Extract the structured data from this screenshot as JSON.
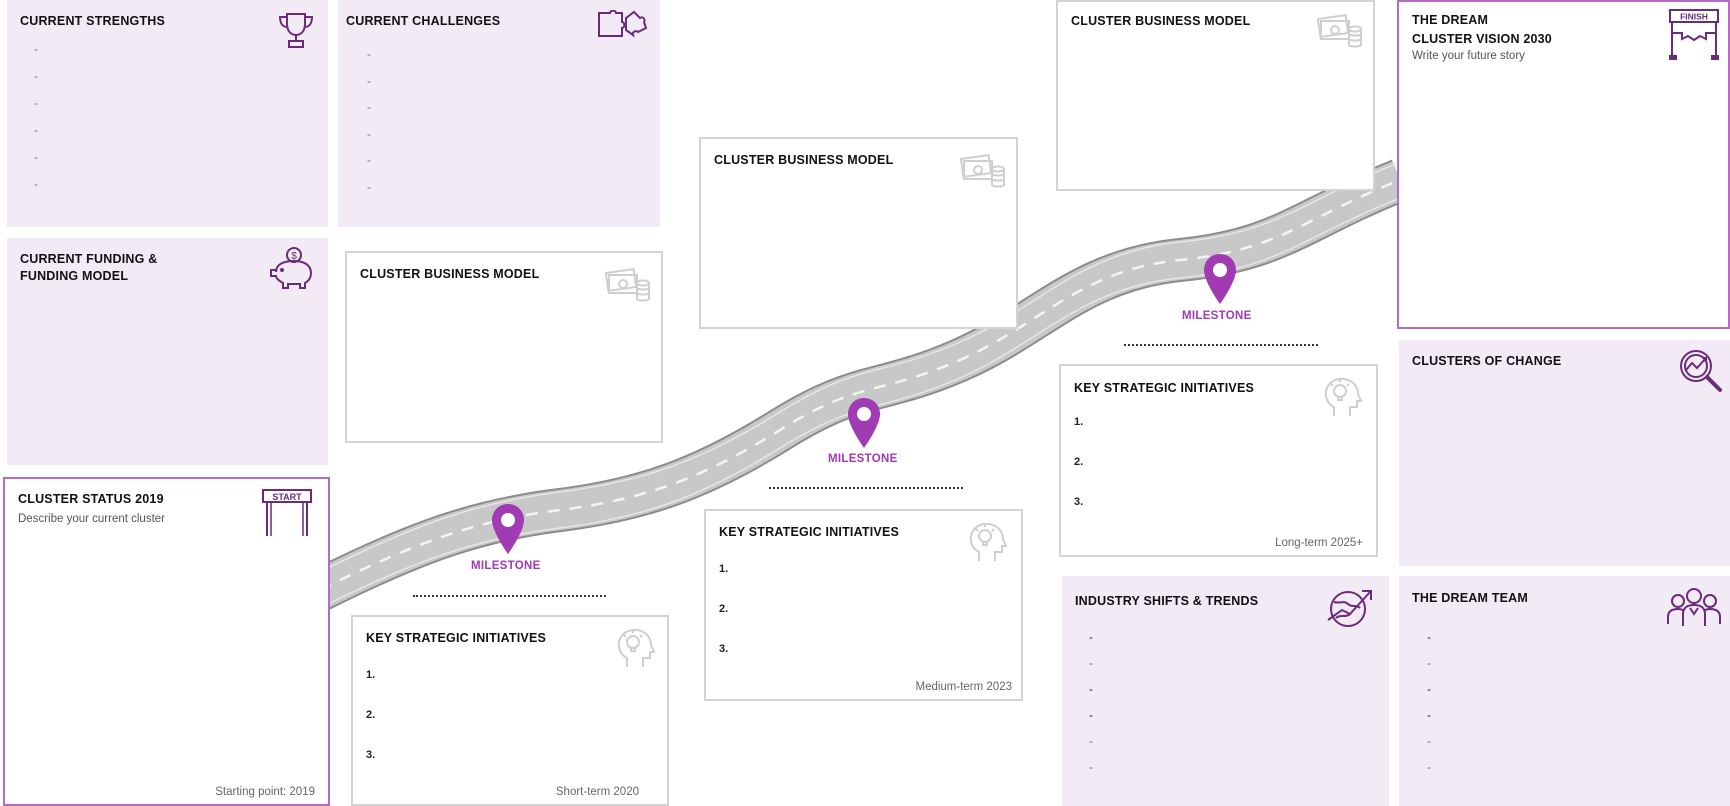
{
  "road_color": "#c8c8c8",
  "accent_color": "#a03bb4",
  "strengths": {
    "title": "CURRENT STRENGTHS",
    "icon": "trophy-icon",
    "bullets": [
      "-",
      "-",
      "-",
      "-",
      "-",
      "-"
    ]
  },
  "challenges": {
    "title": "CURRENT CHALLENGES",
    "icon": "puzzle-icon",
    "bullets": [
      "-",
      "-",
      "-",
      "-",
      "-",
      "-"
    ]
  },
  "funding": {
    "title": "CURRENT FUNDING &\nFUNDING MODEL",
    "icon": "piggy-bank-icon"
  },
  "status": {
    "title": "CLUSTER STATUS 2019",
    "subtitle": "Describe your current cluster",
    "footer": "Starting point: 2019",
    "sign": "START"
  },
  "bm_short": {
    "title": "CLUSTER BUSINESS MODEL",
    "icon": "money-icon"
  },
  "bm_medium": {
    "title": "CLUSTER BUSINESS MODEL",
    "icon": "money-icon"
  },
  "bm_long": {
    "title": "CLUSTER BUSINESS MODEL",
    "icon": "money-icon"
  },
  "ksi_short": {
    "title": "KEY STRATEGIC INITIATIVES",
    "items": [
      "1.",
      "2.",
      "3."
    ],
    "footer": "Short-term 2020",
    "icon": "idea-head-icon"
  },
  "ksi_medium": {
    "title": "KEY STRATEGIC INITIATIVES",
    "items": [
      "1.",
      "2.",
      "3."
    ],
    "footer": "Medium-term 2023",
    "icon": "idea-head-icon"
  },
  "ksi_long": {
    "title": "KEY STRATEGIC INITIATIVES",
    "items": [
      "1.",
      "2.",
      "3."
    ],
    "footer": "Long-term 2025+",
    "icon": "idea-head-icon"
  },
  "milestones": [
    "MILESTONE",
    "MILESTONE",
    "MILESTONE"
  ],
  "dream": {
    "title": "THE DREAM\nCLUSTER VISION 2030",
    "subtitle": "Write your future story",
    "sign": "FINISH"
  },
  "clusters_change": {
    "title": "CLUSTERS OF CHANGE",
    "icon": "magnifier-chart-icon"
  },
  "industry": {
    "title": "INDUSTRY SHIFTS & TRENDS",
    "icon": "globe-trend-icon",
    "bullets": [
      "-",
      "-",
      "-",
      "-",
      "-",
      "-"
    ]
  },
  "team": {
    "title": "THE DREAM TEAM",
    "icon": "team-icon",
    "bullets": [
      "-",
      "-",
      "-",
      "-",
      "-",
      "-"
    ]
  }
}
